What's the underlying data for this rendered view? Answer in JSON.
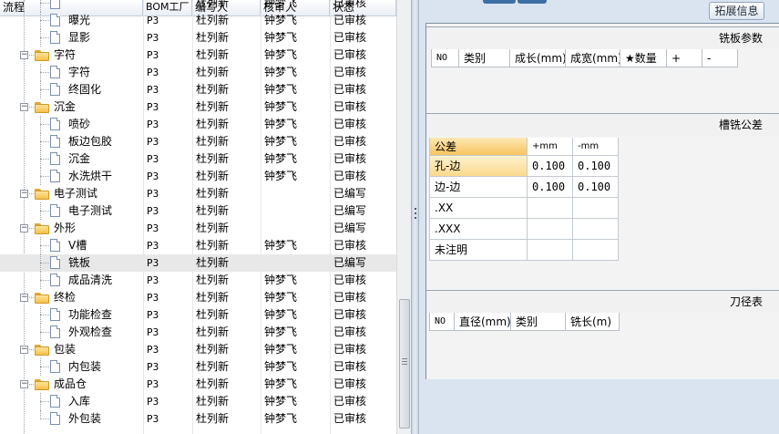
{
  "tree": {
    "columns": [
      "流程",
      "BOM工厂",
      "编写人",
      "核审人",
      "状态"
    ],
    "rows": [
      {
        "level": 1,
        "name": "",
        "plant": "",
        "writer": "杜列新",
        "reviewer": "钟梦飞",
        "status": "已审核",
        "partial": true
      },
      {
        "level": 1,
        "name": "曝光",
        "plant": "P3",
        "writer": "杜列新",
        "reviewer": "钟梦飞",
        "status": "已审核"
      },
      {
        "level": 1,
        "name": "显影",
        "plant": "P3",
        "writer": "杜列新",
        "reviewer": "钟梦飞",
        "status": "已审核"
      },
      {
        "level": 0,
        "name": "字符",
        "plant": "P3",
        "writer": "杜列新",
        "reviewer": "钟梦飞",
        "status": "已审核"
      },
      {
        "level": 1,
        "name": "字符",
        "plant": "P3",
        "writer": "杜列新",
        "reviewer": "钟梦飞",
        "status": "已审核"
      },
      {
        "level": 1,
        "name": "终固化",
        "plant": "P3",
        "writer": "杜列新",
        "reviewer": "钟梦飞",
        "status": "已审核"
      },
      {
        "level": 0,
        "name": "沉金",
        "plant": "P3",
        "writer": "杜列新",
        "reviewer": "钟梦飞",
        "status": "已审核"
      },
      {
        "level": 1,
        "name": "喷砂",
        "plant": "P3",
        "writer": "杜列新",
        "reviewer": "钟梦飞",
        "status": "已审核"
      },
      {
        "level": 1,
        "name": "板边包胶",
        "plant": "P3",
        "writer": "杜列新",
        "reviewer": "钟梦飞",
        "status": "已审核"
      },
      {
        "level": 1,
        "name": "沉金",
        "plant": "P3",
        "writer": "杜列新",
        "reviewer": "钟梦飞",
        "status": "已审核"
      },
      {
        "level": 1,
        "name": "水洗烘干",
        "plant": "P3",
        "writer": "杜列新",
        "reviewer": "钟梦飞",
        "status": "已审核"
      },
      {
        "level": 0,
        "name": "电子测试",
        "plant": "P3",
        "writer": "杜列新",
        "reviewer": "",
        "status": "已编写"
      },
      {
        "level": 1,
        "name": "电子测试",
        "plant": "P3",
        "writer": "杜列新",
        "reviewer": "",
        "status": "已编写"
      },
      {
        "level": 0,
        "name": "外形",
        "plant": "P3",
        "writer": "杜列新",
        "reviewer": "",
        "status": "已编写"
      },
      {
        "level": 1,
        "name": "V槽",
        "plant": "P3",
        "writer": "杜列新",
        "reviewer": "钟梦飞",
        "status": "已审核"
      },
      {
        "level": 1,
        "name": "铣板",
        "plant": "P3",
        "writer": "杜列新",
        "reviewer": "",
        "status": "已编写",
        "selected": true
      },
      {
        "level": 1,
        "name": "成品清洗",
        "plant": "P3",
        "writer": "杜列新",
        "reviewer": "钟梦飞",
        "status": "已审核"
      },
      {
        "level": 0,
        "name": "终检",
        "plant": "P3",
        "writer": "杜列新",
        "reviewer": "钟梦飞",
        "status": "已审核"
      },
      {
        "level": 1,
        "name": "功能检查",
        "plant": "P3",
        "writer": "杜列新",
        "reviewer": "钟梦飞",
        "status": "已审核"
      },
      {
        "level": 1,
        "name": "外观检查",
        "plant": "P3",
        "writer": "杜列新",
        "reviewer": "钟梦飞",
        "status": "已审核"
      },
      {
        "level": 0,
        "name": "包装",
        "plant": "P3",
        "writer": "杜列新",
        "reviewer": "钟梦飞",
        "status": "已审核"
      },
      {
        "level": 1,
        "name": "内包装",
        "plant": "P3",
        "writer": "杜列新",
        "reviewer": "钟梦飞",
        "status": "已审核"
      },
      {
        "level": 0,
        "name": "成品仓",
        "plant": "P3",
        "writer": "杜列新",
        "reviewer": "钟梦飞",
        "status": "已审核"
      },
      {
        "level": 1,
        "name": "入库",
        "plant": "P3",
        "writer": "杜列新",
        "reviewer": "钟梦飞",
        "status": "已审核"
      },
      {
        "level": 1,
        "name": "外包装",
        "plant": "P3",
        "writer": "杜列新",
        "reviewer": "钟梦飞",
        "status": "已审核"
      }
    ]
  },
  "right": {
    "extend_button": "拓展信息",
    "milling": {
      "title": "铣板参数",
      "columns": [
        "NO",
        "类别",
        "成长(mm)",
        "成宽(mm)",
        "★数量",
        "+",
        "-"
      ]
    },
    "tolerance": {
      "title": "槽铣公差",
      "header": [
        "公差",
        "+mm",
        "-mm"
      ],
      "rows": [
        {
          "label": "孔-边",
          "plus": "0.100",
          "minus": "0.100"
        },
        {
          "label": "边-边",
          "plus": "0.100",
          "minus": "0.100"
        },
        {
          "label": ".XX",
          "plus": "",
          "minus": ""
        },
        {
          "label": ".XXX",
          "plus": "",
          "minus": ""
        },
        {
          "label": "未注明",
          "plus": "",
          "minus": ""
        }
      ]
    },
    "tools": {
      "title": "刀径表",
      "columns": [
        "NO",
        "直径(mm)",
        "类别",
        "铣长(m)"
      ]
    }
  }
}
